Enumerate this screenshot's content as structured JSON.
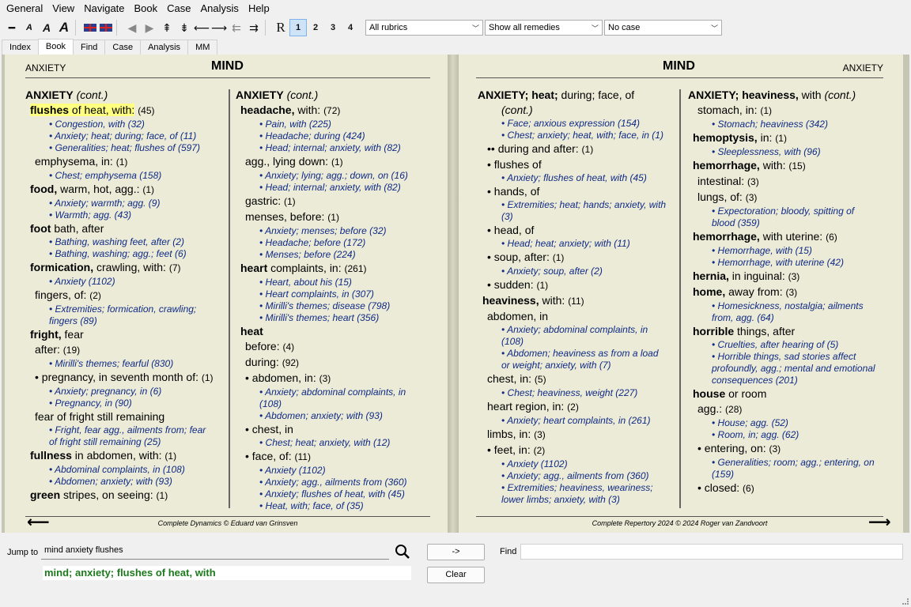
{
  "menu": [
    "General",
    "View",
    "Navigate",
    "Book",
    "Case",
    "Analysis",
    "Help"
  ],
  "toolbar": {
    "buttons": [
      "minus-icon",
      "font-small-icon",
      "font-medium-icon",
      "font-large-icon",
      "flag-uk-icon",
      "flag-uk-icon",
      "arrow-left-icon",
      "arrow-right-icon",
      "arrow-up-double-icon",
      "arrow-down-double-icon",
      "arrow-back-icon",
      "arrow-forward-icon",
      "arrow-back-double-icon",
      "arrow-forward-double-icon"
    ],
    "r_label": "R",
    "levels": [
      "1",
      "2",
      "3",
      "4"
    ],
    "active_level": "1",
    "rubrics_select": "All rubrics",
    "remedies_select": "Show all remedies",
    "case_select": "No case"
  },
  "tabs": [
    "Index",
    "Book",
    "Find",
    "Case",
    "Analysis",
    "MM"
  ],
  "active_tab": "Book",
  "left_page": {
    "header_small": "ANXIETY",
    "header_big": "MIND",
    "footer": "Complete Dynamics © Eduard van Grinsven"
  },
  "right_page": {
    "header_small": "ANXIETY",
    "header_big": "MIND",
    "footer": "Complete Repertory 2024 © 2024 Roger van Zandvoort"
  },
  "bottom": {
    "jump_label": "Jump to",
    "jump_value": "mind anxiety flushes",
    "go_button": "->",
    "clear_button": "Clear",
    "find_label": "Find",
    "find_value": "",
    "result_text": "mind; anxiety; flushes of heat, with"
  },
  "colors": {
    "page": "#ebebd8",
    "xref": "#102a85",
    "highlight": "#ffff80",
    "result": "#1c7a1c"
  }
}
